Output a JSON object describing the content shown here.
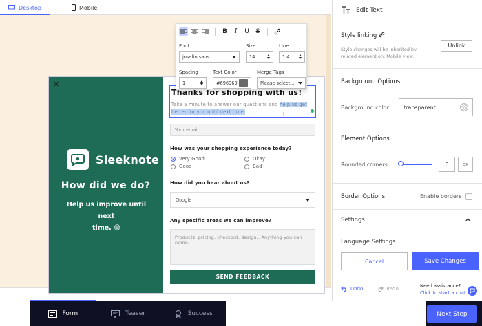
{
  "top_tabs": {
    "desktop": "Desktop",
    "mobile": "Mobile"
  },
  "form": {
    "title": "Thanks for shopping with us!",
    "desc_plain": "Take a minute to answer our questions and ",
    "desc_selected": "help us get better for you until next time.",
    "email_placeholder": "Your email",
    "q1": "How was your shopping experience today?",
    "options": [
      "Very Good",
      "Good",
      "Okay",
      "Bad"
    ],
    "q2": "How did you hear about us?",
    "select_value": "Google",
    "q3": "Any specific areas we can improve?",
    "textarea_placeholder": "Products, pricing, checkout, design.. Anything you can name.",
    "send_label": "SEND FEEDBACK"
  },
  "brand": {
    "logo_text": "Sleeknote",
    "headline": "How did we do?",
    "help_line1": "Help us improve until next",
    "help_line2": "time. 😁"
  },
  "toolbar": {
    "font_label": "Font",
    "font_value": "josefin sans",
    "size_label": "Size",
    "size_value": "14",
    "line_label": "Line",
    "line_value": "1.4",
    "spacing_label": "Spacing",
    "spacing_value": "1",
    "color_label": "Text Color",
    "color_value": "#696969",
    "merge_label": "Merge Tags",
    "merge_value": "Please select..."
  },
  "panel": {
    "title": "Edit Text",
    "style_linking": "Style linking",
    "style_desc": "Style changes will be inherited by related element on: Mobile view.",
    "unlink": "Unlink",
    "bg_options": "Background Options",
    "bg_color_label": "Background color",
    "bg_color_value": "transparent",
    "element_options": "Element Options",
    "rounded_label": "Rounded corners",
    "rounded_value": "0",
    "rounded_unit": "px",
    "border_options": "Border Options",
    "enable_borders": "Enable borders",
    "settings": "Settings",
    "language_settings": "Language Settings",
    "cancel": "Cancel",
    "save": "Save Changes",
    "undo": "Undo",
    "redo": "Redo",
    "need_assistance": "Need assistance?",
    "click_chat": "Click to start a chat"
  },
  "bottom_tabs": {
    "form": "Form",
    "teaser": "Teaser",
    "success": "Success",
    "next_step": "Next Step"
  },
  "colors": {
    "accent": "#4a63ff",
    "brand_green": "#1e6b56",
    "background": "#fbf0df",
    "bottom_bar": "#0f1023"
  }
}
